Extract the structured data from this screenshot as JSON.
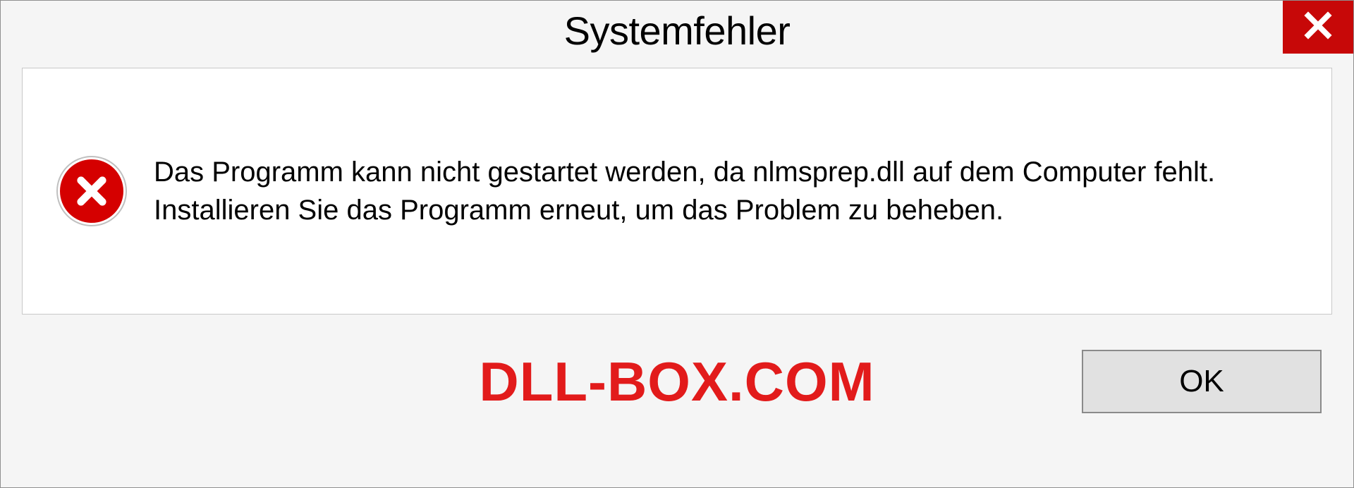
{
  "dialog": {
    "title": "Systemfehler",
    "message": "Das Programm kann nicht gestartet werden, da nlmsprep.dll auf dem Computer fehlt. Installieren Sie das Programm erneut, um das Problem zu beheben.",
    "ok_label": "OK"
  },
  "watermark": "DLL-BOX.COM",
  "colors": {
    "close_bg": "#c70808",
    "error_icon": "#d50000",
    "watermark": "#e21b1b"
  }
}
